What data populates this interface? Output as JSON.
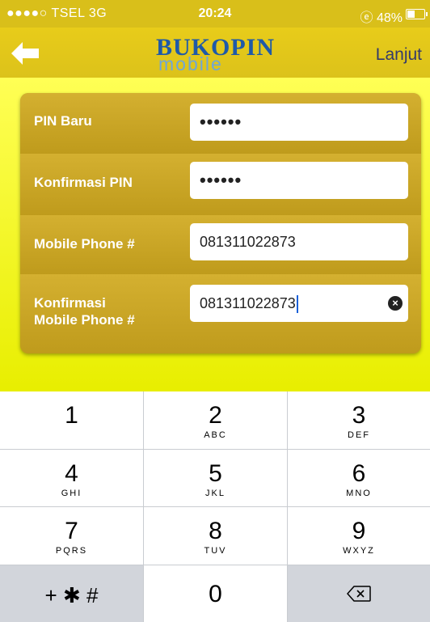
{
  "status_bar": {
    "carrier": "●●●●○ TSEL  3G",
    "time": "20:24",
    "battery": "ⓔ 48%",
    "battery_level": 0.48
  },
  "nav": {
    "back_icon": "left-arrow-icon",
    "logo_brand": "BUKOPIN",
    "logo_sub": "mobile",
    "next_label": "Lanjut"
  },
  "form": {
    "fields": [
      {
        "label": "PIN Baru",
        "value": "••••••"
      },
      {
        "label": "Konfirmasi PIN",
        "value": "••••••"
      },
      {
        "label": "Mobile Phone #",
        "value": "081311022873"
      },
      {
        "label_line1": "Konfirmasi",
        "label_line2": "Mobile Phone #",
        "value": "081311022873"
      }
    ]
  },
  "keypad": {
    "keys": [
      {
        "num": "1",
        "letters": ""
      },
      {
        "num": "2",
        "letters": "ABC"
      },
      {
        "num": "3",
        "letters": "DEF"
      },
      {
        "num": "4",
        "letters": "GHI"
      },
      {
        "num": "5",
        "letters": "JKL"
      },
      {
        "num": "6",
        "letters": "MNO"
      },
      {
        "num": "7",
        "letters": "PQRS"
      },
      {
        "num": "8",
        "letters": "TUV"
      },
      {
        "num": "9",
        "letters": "WXYZ"
      },
      {
        "num": "0",
        "letters": ""
      }
    ],
    "symbols": "+ ✱ #",
    "delete_icon": "backspace-icon"
  }
}
